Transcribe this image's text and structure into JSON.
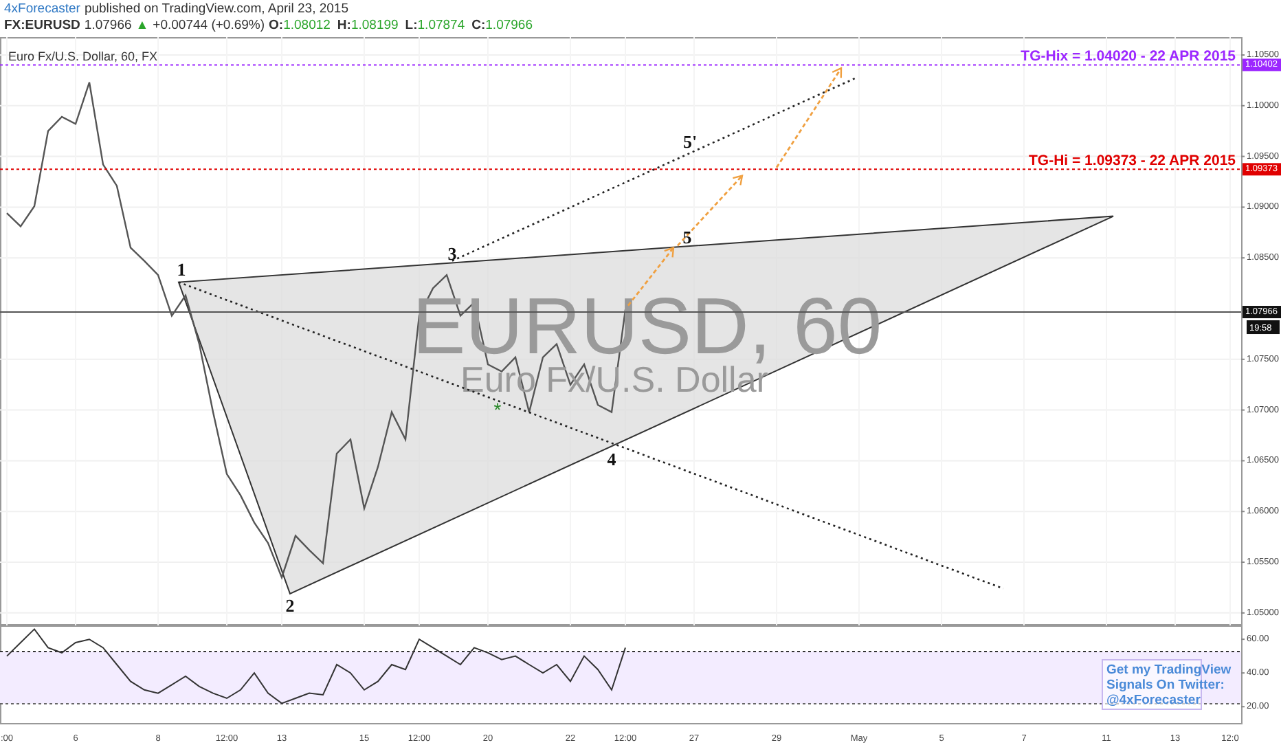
{
  "publish_line": {
    "author": "4xForecaster",
    "text": "published on TradingView.com, April 23, 2015"
  },
  "quote": {
    "symbol": "FX:EURUSD",
    "last": "1.07966",
    "change_icon": "▲",
    "change": "+0.00744 (+0.69%)",
    "ohlc": [
      {
        "label": "O:",
        "value": "1.08012"
      },
      {
        "label": "H:",
        "value": "1.08199"
      },
      {
        "label": "L:",
        "value": "1.07874"
      },
      {
        "label": "C:",
        "value": "1.07966"
      }
    ]
  },
  "legend": "Euro Fx/U.S. Dollar, 60, FX",
  "symbol_watermark": {
    "title": "EURUSD, 60",
    "subtitle": "Euro Fx/U.S. Dollar"
  },
  "price_chart": {
    "chart_data": {
      "type": "line",
      "ylim": [
        1.04877,
        1.10676
      ],
      "yticks": [
        {
          "value": 1.05,
          "label": "1.05000"
        },
        {
          "value": 1.055,
          "label": "1.05500"
        },
        {
          "value": 1.06,
          "label": "1.06000"
        },
        {
          "value": 1.065,
          "label": "1.06500"
        },
        {
          "value": 1.07,
          "label": "1.07000"
        },
        {
          "value": 1.075,
          "label": "1.07500"
        },
        {
          "value": 1.085,
          "label": "1.08500"
        },
        {
          "value": 1.09,
          "label": "1.09000"
        },
        {
          "value": 1.095,
          "label": "1.09500"
        },
        {
          "value": 1.1,
          "label": "1.10000"
        },
        {
          "value": 1.105,
          "label": "1.10500"
        }
      ],
      "categories": [
        null,
        null,
        null,
        null,
        null,
        null,
        null,
        null,
        null,
        null,
        null,
        null,
        null,
        null,
        null,
        null,
        null,
        null,
        null,
        null,
        null,
        null,
        null,
        null,
        null,
        null,
        null,
        null,
        null,
        null,
        null,
        null,
        null,
        null,
        null,
        null,
        null,
        null,
        null,
        null,
        null,
        null,
        null,
        null,
        null,
        null,
        null,
        null,
        null,
        null,
        null,
        null,
        null,
        null,
        null,
        null,
        null,
        null,
        null,
        null,
        null,
        null,
        null,
        null,
        null,
        null,
        null,
        null,
        null,
        null,
        null,
        null,
        null,
        null,
        null,
        null,
        null,
        null,
        null,
        null,
        null,
        null,
        null,
        null,
        null,
        null,
        null,
        null,
        null,
        null
      ],
      "series": [
        {
          "color": "#555555",
          "values": [
            1.0894,
            1.0881,
            1.0901,
            1.0975,
            1.0989,
            1.0982,
            1.1023,
            1.0942,
            1.0921,
            1.086,
            1.0847,
            1.0833,
            1.0793,
            1.0813,
            1.0765,
            1.0698,
            1.0637,
            1.0616,
            1.0589,
            1.0569,
            1.0535,
            1.0576,
            1.0562,
            1.0549,
            1.0657,
            1.0671,
            1.0603,
            1.0644,
            1.0698,
            1.0671,
            1.0793,
            1.082,
            1.0833,
            1.0793,
            1.0806,
            1.0745,
            1.0738,
            1.0752,
            1.0698,
            1.0752,
            1.0765,
            1.0725,
            1.0745,
            1.0705,
            1.0698,
            1.0799,
            null,
            null,
            null,
            null,
            null,
            null,
            null,
            null,
            null,
            null,
            null,
            null,
            null,
            null,
            null,
            null,
            null,
            null,
            null,
            null,
            null,
            null,
            null,
            null,
            null,
            null,
            null,
            null,
            null,
            null,
            null,
            null,
            null,
            null,
            null,
            null,
            null,
            null,
            null,
            null,
            null,
            null,
            null,
            null
          ]
        }
      ],
      "grid": true,
      "ref_lines": [
        {
          "axis": "y",
          "value": 1.10402,
          "color": "#9c27ff",
          "label": "1.10402"
        },
        {
          "axis": "y",
          "value": 1.09373,
          "color": "#e00000",
          "label": "1.09373"
        },
        {
          "axis": "y",
          "value": 1.07966,
          "color": "#555555",
          "label": "1.07966"
        }
      ],
      "annotations": [
        "*",
        "1",
        "2",
        "3",
        "4",
        "5",
        "5'"
      ]
    }
  },
  "target_labels": [
    "TG-Hix = 1.04020 - 22 APR 2015",
    "TG-Hi = 1.09373 - 22 APR 2015"
  ],
  "countdown": "19:58",
  "rsi_chart": {
    "chart_data": {
      "type": "line",
      "ylim": [
        9.5,
        68.2
      ],
      "yticks": [
        {
          "value": 20,
          "label": "20.00"
        },
        {
          "value": 40,
          "label": "40.00"
        },
        {
          "value": 60,
          "label": "60.00"
        }
      ],
      "categories": [
        ":00",
        null,
        null,
        null,
        null,
        "6",
        null,
        null,
        null,
        null,
        null,
        "8",
        null,
        null,
        null,
        null,
        "12:00",
        null,
        null,
        null,
        "13",
        null,
        null,
        null,
        null,
        null,
        "15",
        null,
        null,
        null,
        "12:00",
        null,
        null,
        null,
        null,
        "20",
        null,
        null,
        null,
        null,
        null,
        "22",
        null,
        null,
        null,
        "12:00",
        null,
        null,
        null,
        null,
        "27",
        null,
        null,
        null,
        null,
        null,
        "29",
        null,
        null,
        null,
        null,
        null,
        "May",
        null,
        null,
        null,
        null,
        null,
        "5",
        null,
        null,
        null,
        null,
        null,
        "7",
        null,
        null,
        null,
        null,
        null,
        "11",
        null,
        null,
        null,
        null,
        "13",
        null,
        null,
        null,
        "12:0"
      ],
      "series": [
        {
          "color": "#333333",
          "values": [
            50,
            58,
            66,
            55,
            52,
            58,
            60,
            55,
            45,
            35,
            30,
            28,
            33,
            38,
            32,
            28,
            25,
            30,
            40,
            28,
            22,
            25,
            28,
            27,
            45,
            40,
            30,
            35,
            45,
            42,
            60,
            55,
            50,
            45,
            55,
            52,
            48,
            50,
            45,
            40,
            45,
            35,
            50,
            42,
            30,
            55,
            null,
            null,
            null,
            null,
            null,
            null,
            null,
            null,
            null,
            null,
            null,
            null,
            null,
            null,
            null,
            null,
            null,
            null,
            null,
            null,
            null,
            null,
            null,
            null,
            null,
            null,
            null,
            null,
            null,
            null,
            null,
            null,
            null,
            null,
            null,
            null,
            null,
            null,
            null,
            null,
            null,
            null,
            null,
            null
          ]
        }
      ],
      "ref_lines": [
        {
          "axis": "y",
          "value": 52.7,
          "color": "#333333"
        },
        {
          "axis": "y",
          "value": 21.7,
          "color": "#666666"
        }
      ]
    }
  },
  "signal_note": [
    "Get my TradingView",
    "Signals On Twitter:",
    "@4xForecaster"
  ]
}
